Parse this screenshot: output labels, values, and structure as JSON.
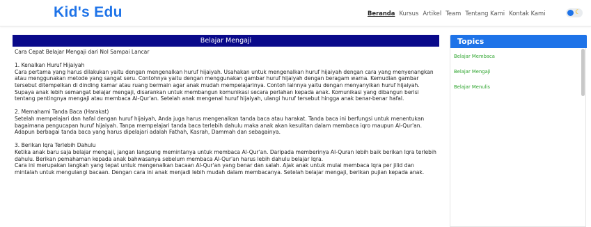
{
  "brand": "Kid's Edu",
  "nav": [
    "Beranda",
    "Kursus",
    "Artikel",
    "Team",
    "Tentang Kami",
    "Kontak Kami"
  ],
  "toggle_icon": "moon-icon",
  "article": {
    "title": "Belajar Mengaji",
    "intro": "Cara Cepat Belajar Mengaji dari Nol Sampai Lancar",
    "sections": [
      {
        "heading": "1. Kenalkan Huruf Hijaiyah",
        "paragraphs": [
          "Cara pertama yang harus dilakukan yaitu dengan mengenalkan huruf hijaiyah. Usahakan untuk mengenalkan huruf hijaiyah dengan cara yang menyenangkan atau menggunakan metode yang sangat seru. Contohnya yaitu dengan menggunakan gambar huruf hijaiyah dengan beragam warna. Kemudian gambar tersebut ditempelkan di dinding kamar atau ruang bermain agar anak mudah mempelajarinya. Contoh lainnya yaitu dengan menyanyikan huruf hijaiyah.",
          "Supaya anak lebih semangat belajar mengaji, disarankan untuk membangun komunikasi secara perlahan kepada anak. Komunikasi yang dibangun berisi tentang pentingnya mengaji atau membaca Al-Qur'an. Setelah anak mengenal huruf hijaiyah, ulangi huruf tersebut hingga anak benar-benar hafal."
        ]
      },
      {
        "heading": "2. Memahami Tanda Baca (Harakat)",
        "paragraphs": [
          "Setelah mempelajari dan hafal dengan huruf hijaiyah, Anda juga harus mengenalkan tanda baca atau harakat. Tanda baca ini berfungsi untuk menentukan bagaimana pengucapan huruf hijaiyah. Tanpa mempelajari tanda baca terlebih dahulu maka anak akan kesulitan dalam membaca iqro maupun Al-Qur'an. Adapun berbagai tanda baca yang harus dipelajari adalah Fathah, Kasrah, Dammah dan sebagainya."
        ]
      },
      {
        "heading": "3. Berikan Iqra Terlebih Dahulu",
        "paragraphs": [
          "Ketika anak baru saja belajar mengaji, jangan langsung memintanya untuk membaca Al-Qur'an. Daripada memberinya Al-Quran lebih baik berikan Iqra terlebih dahulu. Berikan pemahaman kepada anak bahwasanya sebelum membaca Al-Qur'an harus lebih dahulu belajar Iqra.",
          "Cara ini merupakan langkah yang tepat untuk mengenalkan bacaan Al-Qur'an yang benar dan salah. Ajak anak untuk mulai membaca Iqra per jilid dan mintalah untuk mengulangi bacaan. Dengan cara ini anak menjadi lebih mudah dalam membacanya. Setelah belajar mengaji, berikan pujian kepada anak."
        ]
      }
    ]
  },
  "sidebar": {
    "title": "Topics",
    "items": [
      "Belajar Membaca",
      "Belajar Mengaji",
      "Belajar Menulis"
    ]
  }
}
